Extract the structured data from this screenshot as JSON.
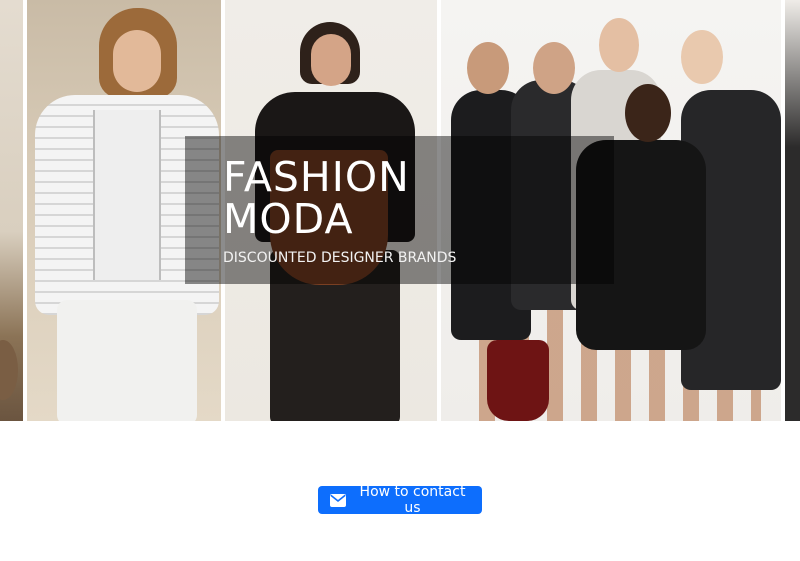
{
  "hero": {
    "title_line1": "FASHION",
    "title_line2": "MODA",
    "subtitle": "DISCOUNTED DESIGNER BRANDS"
  },
  "contact": {
    "label": "How to contact us",
    "icon": "envelope-icon"
  },
  "colors": {
    "button": "#0d6efd",
    "overlay": "rgba(0,0,0,0.45)",
    "text_light": "#ffffff"
  }
}
